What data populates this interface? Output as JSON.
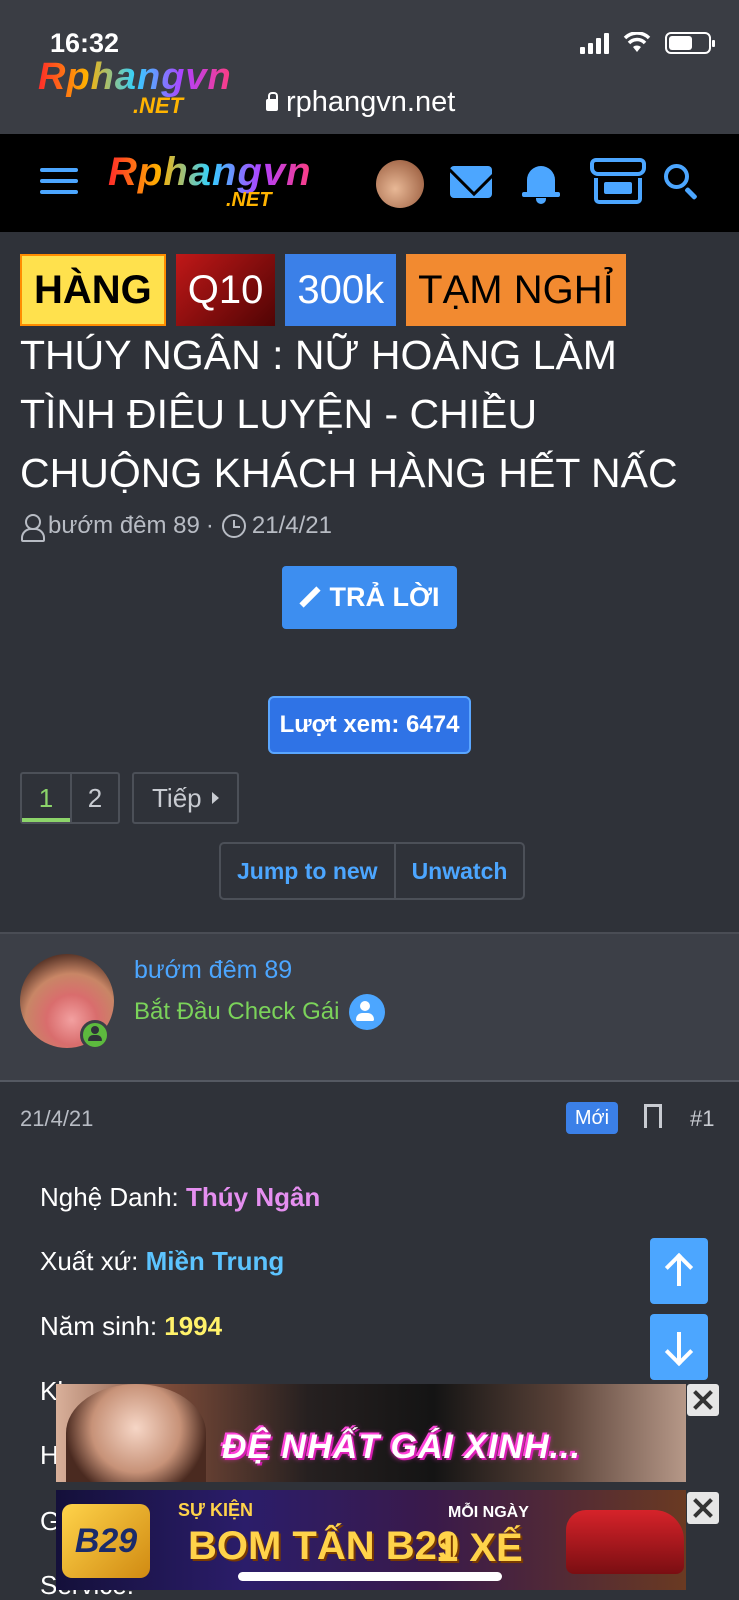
{
  "status_bar": {
    "time": "16:32"
  },
  "browser": {
    "site_logo": "Rphangvn",
    "site_logo_suffix": ".NET",
    "url": "rphangvn.net"
  },
  "navbar": {
    "logo": "Rphangvn",
    "logo_suffix": ".NET"
  },
  "thread": {
    "prefixes": [
      "HÀNG",
      "Q10",
      "300k",
      "TẠM NGHỈ"
    ],
    "title": "THÚY NGÂN : NỮ HOÀNG LÀM TÌNH ĐIÊU LUYỆN - CHIỀU CHUỘNG KHÁCH HÀNG HẾT NẤC",
    "author": "bướm đêm 89",
    "separator": "·",
    "date": "21/4/21",
    "reply_label": "TRẢ LỜI",
    "views_label": "Lượt xem: 6474",
    "pages": [
      "1",
      "2"
    ],
    "next_label": "Tiếp",
    "jump_label": "Jump to new",
    "unwatch_label": "Unwatch"
  },
  "post": {
    "username": "bướm đêm 89",
    "rank": "Bắt Đầu Check Gái",
    "date": "21/4/21",
    "new_badge": "Mới",
    "number": "#1",
    "fields": [
      {
        "label": "Nghệ Danh: ",
        "value": "Thúy Ngân",
        "color": "#e58ff0"
      },
      {
        "label": "Xuất xứ: ",
        "value": "Miền Trung",
        "color": "#5cc4ff"
      },
      {
        "label": "Năm sinh: ",
        "value": "1994",
        "color": "#fff26a"
      }
    ],
    "partial_lines": [
      "Kh",
      "H",
      "G",
      "Service:"
    ]
  },
  "ads": {
    "ad1_text": "ĐỆ NHẤT GÁI XINH...",
    "ad2_logo": "B29",
    "ad2_event": "SỰ KIỆN",
    "ad2_main": "BOM TẤN B29",
    "ad2_daily": "MỖI NGÀY",
    "ad2_prize": "1 XẾ"
  },
  "colors": {
    "accent": "#4ca6ff",
    "background": "#2f3239",
    "online": "#5dba3e",
    "rank": "#7bd35a"
  }
}
